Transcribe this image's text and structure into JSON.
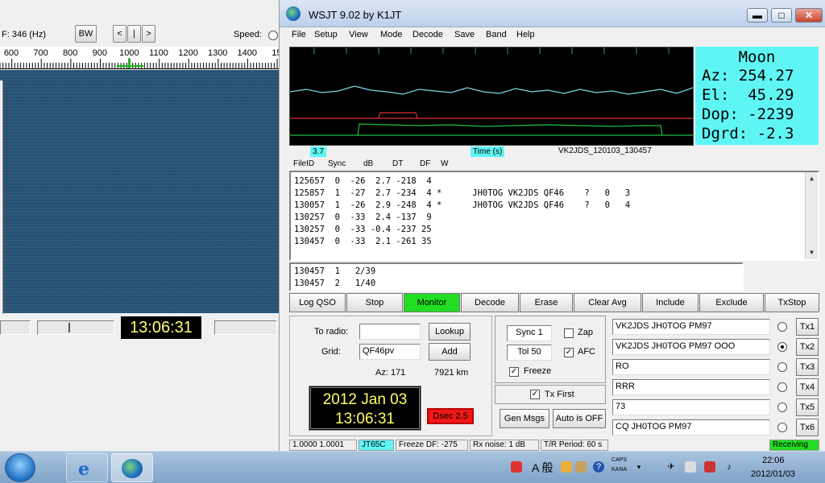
{
  "waterfall": {
    "freq_label": "F:  346  (Hz)",
    "bw_button": "BW",
    "nav_left": "<",
    "nav_center": "|",
    "nav_right": ">",
    "speed_label": "Speed:",
    "scale_ticks": [
      "600",
      "700",
      "800",
      "900",
      "1000",
      "1100",
      "1200",
      "1300",
      "1400",
      "15"
    ],
    "clock": "13:06:31"
  },
  "window": {
    "title": "WSJT 9.02    by K1JT",
    "minimize": "▬",
    "maximize": "□",
    "close": "✕"
  },
  "menu": [
    "File",
    "Setup",
    "View",
    "Mode",
    "Decode",
    "Save",
    "Band",
    "Help"
  ],
  "moon": {
    "title": "Moon",
    "az": "Az: 254.27",
    "el": "El:  45.29",
    "dop": "Dop: -2239",
    "dgrd": "Dgrd: -2.3"
  },
  "plot_axis": {
    "left_tag": "3.7",
    "time_label": "Time (s)",
    "file_name": "VK2JDS_120103_130457"
  },
  "decode_headers": [
    "FileID",
    "Sync",
    "dB",
    "DT",
    "DF",
    "W"
  ],
  "decodes": [
    "125657  0  -26  2.7 -218  4",
    "125857  1  -27  2.7 -234  4 *      JH0TOG VK2JDS QF46    ?   0   3",
    "130057  1  -26  2.9 -248  4 *      JH0TOG VK2JDS QF46    ?   0   4",
    "130257  0  -33  2.4 -137  9",
    "130257  0  -33 -0.4 -237 25",
    "130457  0  -33  2.1 -261 35"
  ],
  "averages": [
    "130457  1   2/39",
    "130457  2   1/40"
  ],
  "buttons": [
    "Log QSO",
    "Stop",
    "Monitor",
    "Decode",
    "Erase",
    "Clear Avg",
    "Include",
    "Exclude",
    "TxStop"
  ],
  "radio": {
    "to_radio_label": "To radio:",
    "to_radio_value": "",
    "lookup": "Lookup",
    "grid_label": "Grid:",
    "grid_value": "QF46pv",
    "add": "Add",
    "az": "Az: 171",
    "distance": "7921 km",
    "date": "2012 Jan 03",
    "time": "13:06:31",
    "dsec": "Dsec  2.5"
  },
  "controls": {
    "sync": "Sync  1",
    "zap": "Zap",
    "tol": "Tol   50",
    "afc": "AFC",
    "freeze": "Freeze",
    "tx_first": "Tx First",
    "gen_msgs": "Gen Msgs",
    "auto": "Auto is OFF"
  },
  "tx_messages": [
    {
      "text": "VK2JDS JH0TOG PM97",
      "button": "Tx1"
    },
    {
      "text": "VK2JDS JH0TOG PM97 OOO",
      "button": "Tx2"
    },
    {
      "text": "RO",
      "button": "Tx3"
    },
    {
      "text": "RRR",
      "button": "Tx4"
    },
    {
      "text": "73",
      "button": "Tx5"
    },
    {
      "text": "CQ JH0TOG PM97",
      "button": "Tx6"
    }
  ],
  "status": {
    "s1": "1.0000  1.0001",
    "s2": "JT65C",
    "s3": "Freeze DF: -275",
    "s4": "Rx noise: 1 dB",
    "s5": "T/R Period: 60 s",
    "s6": "Receiving"
  },
  "taskbar": {
    "ime": "A 般",
    "caps": "CAPS",
    "kana": "KANA",
    "time": "22:06",
    "date": "2012/01/03"
  },
  "colors": {
    "moon_bg": "#5ff5f5",
    "monitor_active": "#22dd22",
    "dsec_bg": "#f01818",
    "clock_fg": "#ffff66",
    "receiving_bg": "#22dd22"
  }
}
